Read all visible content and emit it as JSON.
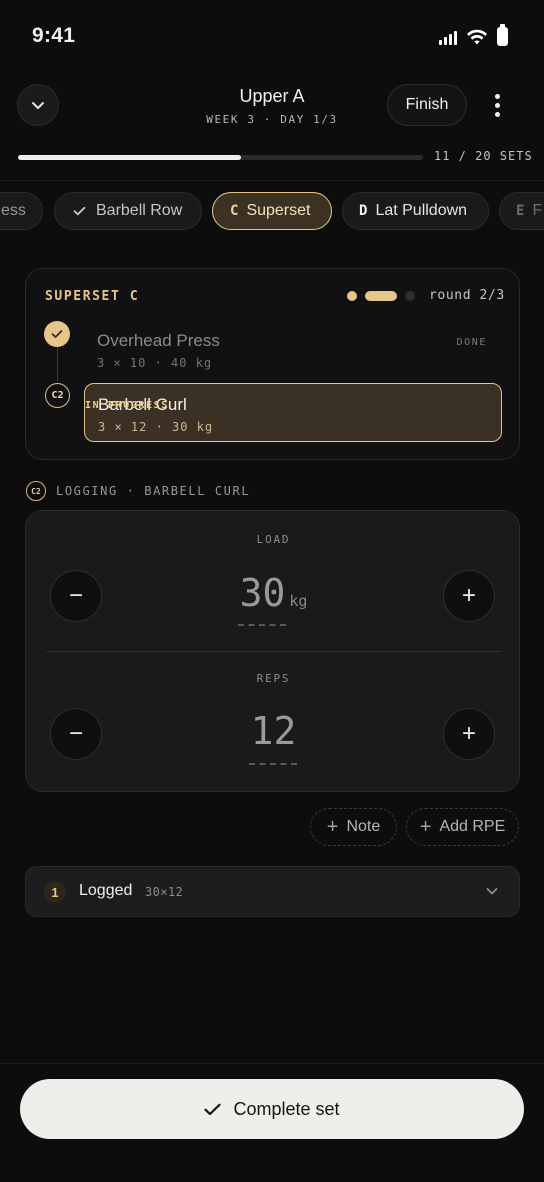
{
  "status_bar": {
    "time": "9:41"
  },
  "header": {
    "title": "Upper A",
    "subtitle": "WEEK 3 · DAY 1/3",
    "finish_label": "Finish"
  },
  "progress": {
    "label": "11 / 20 SETS",
    "completed": 11,
    "total": 20
  },
  "chips": [
    {
      "letter": "",
      "label": "ess",
      "state": "done"
    },
    {
      "letter": "",
      "label": "Barbell Row",
      "state": "done"
    },
    {
      "letter": "C",
      "label": "Superset",
      "state": "active"
    },
    {
      "letter": "D",
      "label": "Lat Pulldown",
      "state": "upcoming"
    },
    {
      "letter": "E",
      "label": "F",
      "state": "upcoming"
    }
  ],
  "superset": {
    "title": "SUPERSET C",
    "round_label": "round 2/3",
    "rounds_total": 3,
    "rounds_current": 2,
    "exercises": [
      {
        "badge": "",
        "name": "Overhead Press",
        "meta": "3 × 10 · 40 kg",
        "status": "DONE"
      },
      {
        "badge": "C2",
        "name": "Barbell Curl",
        "meta": "3 × 12 · 30 kg",
        "status": "IN PROGRESS"
      }
    ]
  },
  "logging": {
    "badge": "C2",
    "label": "LOGGING · BARBELL CURL"
  },
  "stepper": {
    "load": {
      "label": "LOAD",
      "value": "30",
      "unit": "kg",
      "placeholder": "------"
    },
    "reps": {
      "label": "REPS",
      "value": "12",
      "placeholder": "------"
    },
    "minus": "−",
    "plus": "+"
  },
  "actions": {
    "note_label": "Note",
    "rpe_label": "Add RPE",
    "plus": "+"
  },
  "logged": {
    "count": "1",
    "label": "Logged",
    "value": "30×12"
  },
  "footer": {
    "complete_label": "Complete set"
  },
  "colors": {
    "accent": "#e8c68a",
    "background": "#0d0d0e",
    "card": "#1a1a1c"
  }
}
